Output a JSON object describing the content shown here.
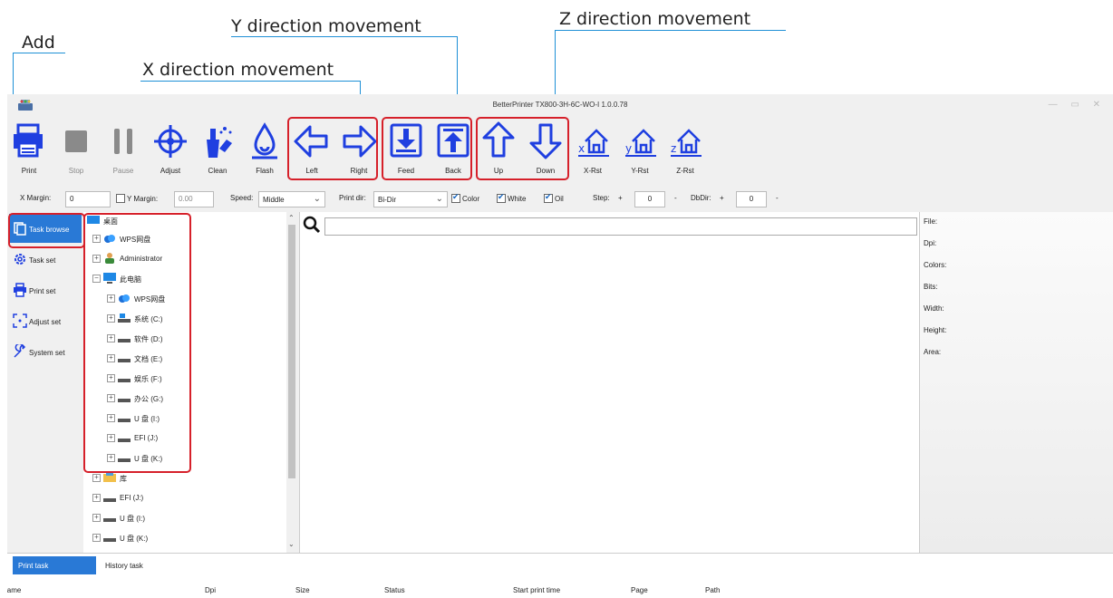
{
  "annotations": {
    "add": "Add",
    "x_move": "X direction movement",
    "y_move": "Y direction movement",
    "z_move": "Z direction movement"
  },
  "window": {
    "title": "BetterPrinter TX800-3H-6C-WO-I 1.0.0.78",
    "controls": "— ▭ ✕"
  },
  "toolbar": {
    "print": "Print",
    "stop": "Stop",
    "pause": "Pause",
    "adjust": "Adjust",
    "clean": "Clean",
    "flash": "Flash",
    "left": "Left",
    "right": "Right",
    "feed": "Feed",
    "back": "Back",
    "up": "Up",
    "down": "Down",
    "x_rst": "X-Rst",
    "y_rst": "Y-Rst",
    "z_rst": "Z-Rst"
  },
  "options": {
    "x_margin_label": "X Margin:",
    "x_margin_value": "0",
    "y_margin_label": "Y Margin:",
    "y_margin_value": "0.00",
    "speed_label": "Speed:",
    "speed_value": "Middle",
    "print_dir_label": "Print dir:",
    "print_dir_value": "Bi-Dir",
    "color_label": "Color",
    "white_label": "White",
    "oil_label": "Oil",
    "step_label": "Step:",
    "step_value": "0",
    "dbdir_label": "DbDir:",
    "dbdir_value": "0",
    "plus": "+",
    "minus": "-"
  },
  "nav": {
    "task_browse": "Task browse",
    "task_set": "Task set",
    "print_set": "Print set",
    "adjust_set": "Adjust set",
    "system_set": "System set"
  },
  "tree": {
    "desktop": "桌面",
    "wps": "WPS网盘",
    "admin": "Administrator",
    "pc": "此电脑",
    "pc_wps": "WPS网盘",
    "c": "系统 (C:)",
    "d": "软件 (D:)",
    "e": "文档 (E:)",
    "f": "娱乐 (F:)",
    "g": "办公 (G:)",
    "i": "U 盘 (I:)",
    "j": "EFI (J:)",
    "k": "U 盘 (K:)",
    "lib": "库",
    "efi2": "EFI (J:)",
    "u1": "U 盘 (I:)",
    "u2": "U 盘 (K:)"
  },
  "info": {
    "file": "File:",
    "dpi": "Dpi:",
    "colors": "Colors:",
    "bits": "Bits:",
    "width": "Width:",
    "height": "Height:",
    "area": "Area:"
  },
  "bottom": {
    "print_task": "Print task",
    "history_task": "History task",
    "columns": {
      "name": "Name",
      "dpi": "Dpi",
      "size": "Size",
      "status": "Status",
      "start": "Start print time",
      "page": "Page",
      "path": "Path"
    }
  },
  "colors": {
    "accent": "#2979d6",
    "icon_blue": "#1f3fe0",
    "annotation_red": "#d6202a",
    "annotation_line": "#1e90d6"
  }
}
